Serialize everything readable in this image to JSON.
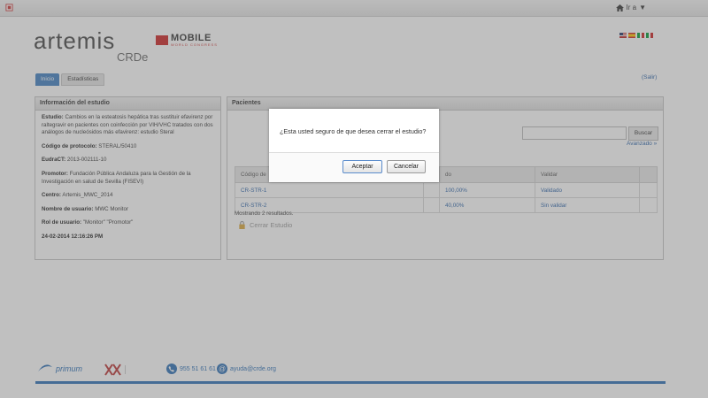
{
  "topbar": {
    "goto_label": "Ir a"
  },
  "logo": {
    "brand": "artemis",
    "product": "CRDe"
  },
  "partner": {
    "name": "MOBILE",
    "sub": "WORLD CONGRESS"
  },
  "tabs": [
    {
      "label": "Inicio",
      "active": true
    },
    {
      "label": "Estadísticas",
      "active": false
    }
  ],
  "salir": "(Salir)",
  "info_panel": {
    "title": "Información del estudio",
    "fields": [
      {
        "label": "Estudio:",
        "value": "Cambios en la esteatosis hepática tras sustituir efavirenz por raltegravir en pacientes con coinfección por VIH/VHC tratados con dos análogos de nucleósidos más efavirenz: estudio Steral"
      },
      {
        "label": "Código de protocolo:",
        "value": "STERAL/50410"
      },
      {
        "label": "EudraCT:",
        "value": "2013-002111-10"
      },
      {
        "label": "Promotor:",
        "value": "Fundación Pública Andaluza para la Gestión de la Investigación en salud de Sevilla (FISEVI)"
      },
      {
        "label": "Centro:",
        "value": "Artemis_MWC_2014"
      },
      {
        "label": "Nombre de usuario:",
        "value": "MWC Monitor"
      },
      {
        "label": "Rol de usuario:",
        "value": "\"Monitor\" \"Promotor\""
      }
    ],
    "datetime": "24-02-2014 12:16:26 PM"
  },
  "pacientes_panel": {
    "title": "Pacientes",
    "search_button": "Buscar",
    "avanzado": "Avanzado »",
    "columns": [
      "Código de",
      "",
      "do",
      "Validar",
      ""
    ],
    "rows": [
      {
        "code": "CR-STR-1",
        "progress": "100,00%",
        "status": "Validado"
      },
      {
        "code": "CR-STR-2",
        "progress": "40,00%",
        "status": "Sin validar"
      }
    ],
    "result_count": "Mostrando 2 resultados.",
    "close_study": "Cerrar Estudio"
  },
  "dialog": {
    "message": "¿Esta usted seguro de que desea cerrar el estudio?",
    "accept": "Aceptar",
    "cancel": "Cancelar"
  },
  "footer": {
    "primum": "primum",
    "phone": "955 51 61 61",
    "web": "ayuda@crde.org"
  },
  "colors": {
    "accent": "#2b6fb6",
    "tab_active": "#3f7fc2",
    "link": "#2a62a8",
    "brand_red": "#cc3333"
  }
}
